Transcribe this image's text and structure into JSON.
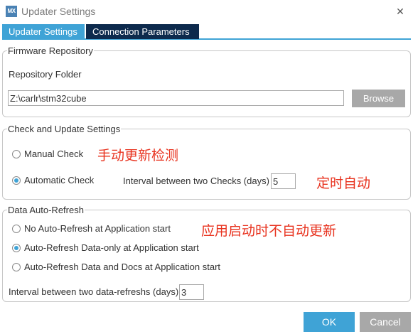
{
  "window": {
    "icon_text": "MX",
    "title": "Updater Settings",
    "close_symbol": "✕"
  },
  "tabs": [
    {
      "label": "Updater Settings",
      "active": true
    },
    {
      "label": "Connection Parameters",
      "active": false
    }
  ],
  "firmware": {
    "legend": "Firmware Repository",
    "folder_label": "Repository Folder",
    "folder_value": "Z:\\carlr\\stm32cube",
    "browse_label": "Browse"
  },
  "check": {
    "legend": "Check and Update Settings",
    "manual_label": "Manual Check",
    "automatic_label": "Automatic Check",
    "selected": "automatic",
    "interval_label": "Interval between two Checks (days)",
    "interval_value": "5"
  },
  "refresh": {
    "legend": "Data Auto-Refresh",
    "options": [
      {
        "label": "No Auto-Refresh at Application start",
        "checked": false
      },
      {
        "label": "Auto-Refresh Data-only at Application start",
        "checked": true
      },
      {
        "label": "Auto-Refresh Data and Docs at Application start",
        "checked": false
      }
    ],
    "interval_label": "Interval between two data-refreshs (days)",
    "interval_value": "3"
  },
  "annotations": {
    "manual": "手动更新检测",
    "auto": "定时自动",
    "no_refresh": "应用启动时不自动更新"
  },
  "footer": {
    "ok_label": "OK",
    "cancel_label": "Cancel"
  },
  "colors": {
    "accent": "#3fa3d6",
    "inactive_tab": "#0d2a4d",
    "gray_button": "#a8a8a8",
    "annotation": "#e8321e"
  }
}
